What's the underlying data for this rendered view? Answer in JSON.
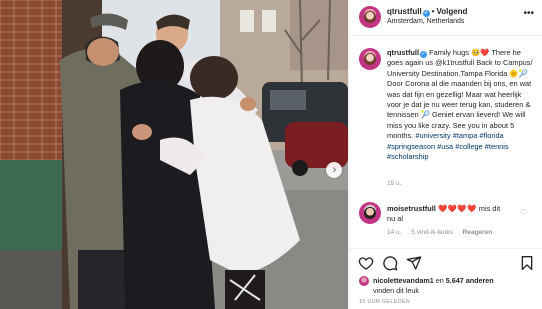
{
  "header": {
    "username": "qtrustfull",
    "follow_label": "Volgend",
    "location": "Amsterdam, Netherlands",
    "more_icon": "more-options-icon"
  },
  "caption": {
    "username": "qtrustfull",
    "text_1": "Family hugs ",
    "text_2": " There he goes again us @k1trustfull Back to Campus/ University Destination,Tampa Florida ",
    "text_3": " Door Corona al die maanden bij ons, en wat was dat fijn en gezellig! Maar wat heerlijk voor je dat je nu weer terug kan, studeren & tennissen ",
    "text_4": " Geniet ervan lieverd! We will miss you like crazy. See you in about 5 months. ",
    "hashtags": "#university #tampa #florida #springseason #usa #college #tennis #scholarship",
    "emoji_1": "🥺❤️",
    "emoji_2": "🌞🎾",
    "emoji_3": "🎾",
    "time": "15 u."
  },
  "comment": {
    "username": "moisetrustfull",
    "hearts": "❤️❤️❤️❤️",
    "text": " mis dit nu al",
    "time": "14 u.",
    "likes": "5 vind-ik-leuks",
    "reply_label": "Reageren"
  },
  "actions": {
    "like_icon": "heart-icon",
    "comment_icon": "comment-icon",
    "share_icon": "paper-plane-icon",
    "save_icon": "bookmark-icon"
  },
  "likes": {
    "first_user": "nicolettevandam1",
    "connector": " en ",
    "others": "5.647 anderen",
    "suffix": " vinden dit leuk"
  },
  "post_time": "15 UUR GELEDEN",
  "colors": {
    "link": "#00376b",
    "verified": "#3897f0",
    "secondary_text": "#8e8e8e",
    "divider": "#efefef"
  }
}
